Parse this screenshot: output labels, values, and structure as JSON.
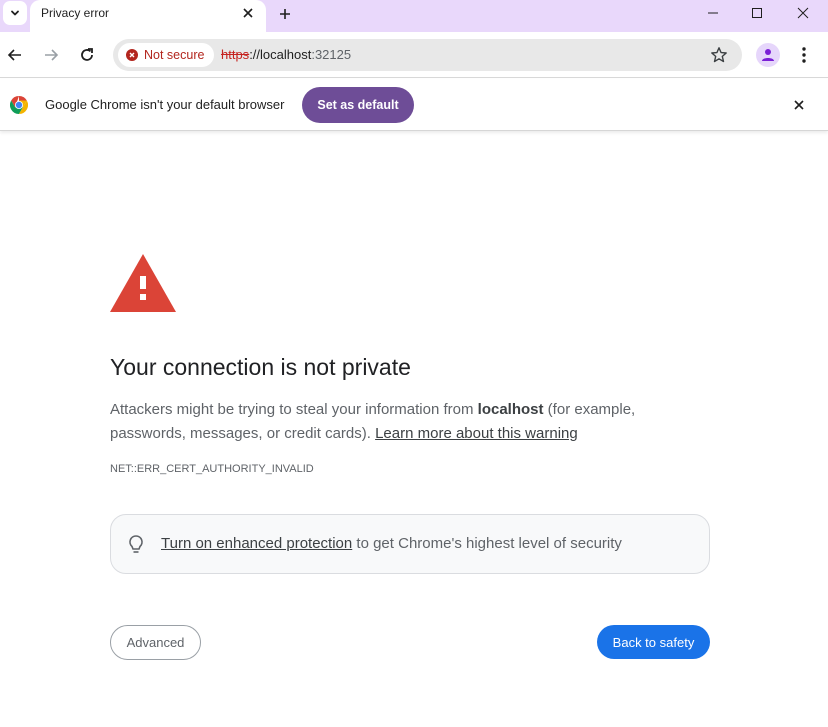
{
  "tabstrip": {
    "tab_title": "Privacy error",
    "icons": {
      "tab_search": "chevron-down-icon",
      "close": "close-icon",
      "new_tab": "plus-icon",
      "minimize": "minimize-icon",
      "maximize": "maximize-icon",
      "window_close": "close-icon"
    }
  },
  "toolbar": {
    "security_chip": "Not secure",
    "url_scheme": "https",
    "url_separator": "://",
    "url_host": "localhost",
    "url_port": ":32125",
    "icons": {
      "back": "arrow-left-icon",
      "forward": "arrow-right-icon",
      "reload": "reload-icon",
      "security": "error-circle-icon",
      "bookmark": "star-icon",
      "profile": "person-icon",
      "menu": "more-vertical-icon"
    }
  },
  "infobar": {
    "message": "Google Chrome isn't your default browser",
    "button": "Set as default",
    "icons": {
      "logo": "chrome-logo-icon",
      "close": "close-icon"
    }
  },
  "interstitial": {
    "heading": "Your connection is not private",
    "desc_pre": "Attackers might be trying to steal your information from ",
    "desc_host": "localhost",
    "desc_post": " (for example, passwords, messages, or credit cards). ",
    "learn_more": "Learn more about this warning",
    "error_code": "NET::ERR_CERT_AUTHORITY_INVALID",
    "enhanced_link": "Turn on enhanced protection",
    "enhanced_text": " to get Chrome's highest level of security",
    "advanced_button": "Advanced",
    "back_button": "Back to safety"
  },
  "colors": {
    "tabstrip_bg": "#e9d8fb",
    "set_default_bg": "#6e4d97",
    "warning_red": "#db4437",
    "primary_blue": "#1a73e8",
    "not_secure_red": "#b3261e"
  }
}
